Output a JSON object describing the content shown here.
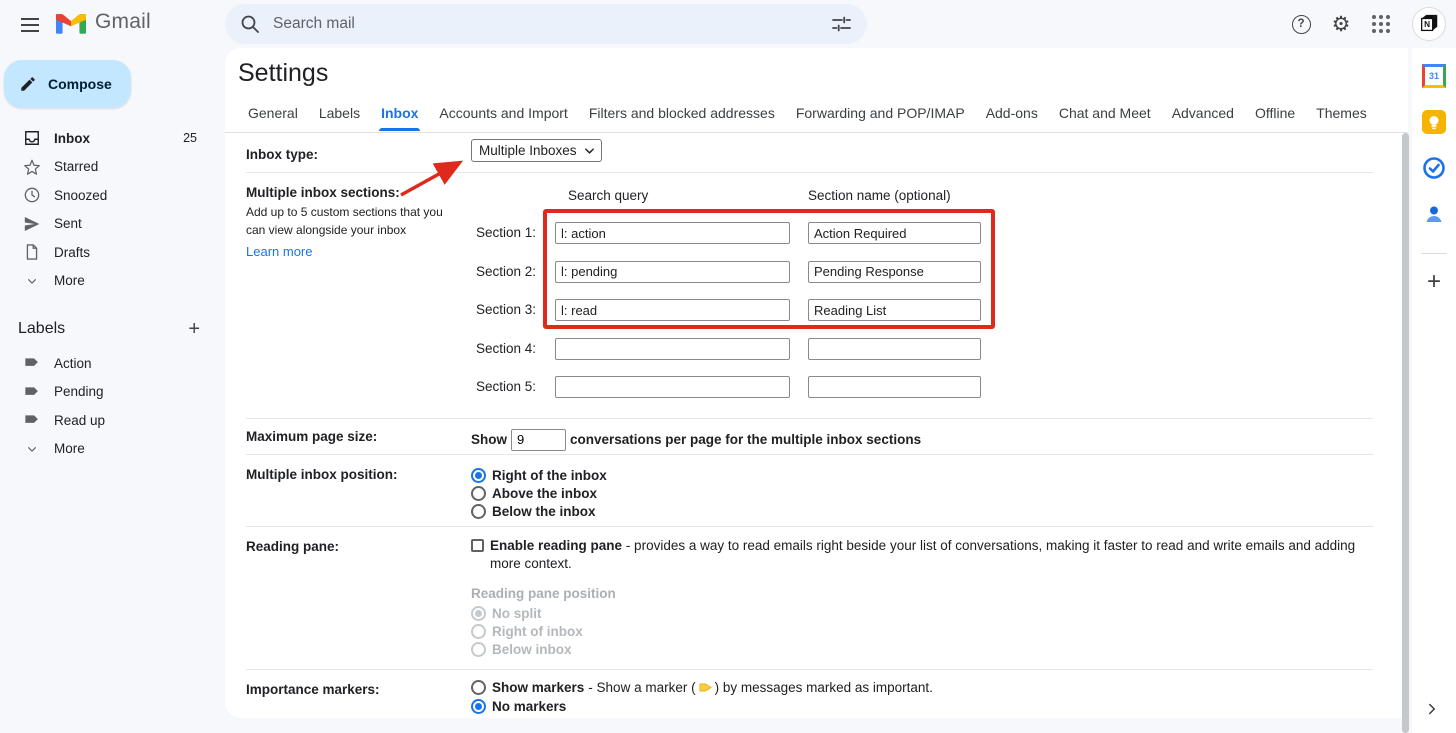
{
  "topbar": {
    "brand": "Gmail",
    "search": {
      "placeholder": "Search mail"
    },
    "icons": {
      "help_glyph": "?",
      "gear_glyph": "⚙",
      "avatar_letter": "N"
    }
  },
  "sidebar": {
    "compose": "Compose",
    "items": [
      {
        "label": "Inbox",
        "count": "25"
      },
      {
        "label": "Starred"
      },
      {
        "label": "Snoozed"
      },
      {
        "label": "Sent"
      },
      {
        "label": "Drafts"
      },
      {
        "label": "More"
      }
    ],
    "labels_header": "Labels",
    "labels_plus": "+",
    "labels": [
      {
        "label": "Action"
      },
      {
        "label": "Pending"
      },
      {
        "label": "Read up"
      },
      {
        "label": "More"
      }
    ]
  },
  "settings": {
    "title": "Settings",
    "tabs": [
      "General",
      "Labels",
      "Inbox",
      "Accounts and Import",
      "Filters and blocked addresses",
      "Forwarding and POP/IMAP",
      "Add-ons",
      "Chat and Meet",
      "Advanced",
      "Offline",
      "Themes"
    ],
    "active_tab": "Inbox",
    "inbox_type": {
      "label": "Inbox type:",
      "value": "Multiple Inboxes"
    },
    "sections": {
      "label": "Multiple inbox sections:",
      "description": "Add up to 5 custom sections that you can view alongside your inbox",
      "learn_more": "Learn more",
      "col_query": "Search query",
      "col_name": "Section name (optional)",
      "rows": [
        {
          "label": "Section 1:",
          "query": "l: action",
          "name": "Action Required"
        },
        {
          "label": "Section 2:",
          "query": "l: pending",
          "name": "Pending Response"
        },
        {
          "label": "Section 3:",
          "query": "l: read",
          "name": "Reading List"
        },
        {
          "label": "Section 4:",
          "query": "",
          "name": ""
        },
        {
          "label": "Section 5:",
          "query": "",
          "name": ""
        }
      ]
    },
    "max_page_size": {
      "label": "Maximum page size:",
      "prefix": "Show",
      "value": "9",
      "suffix": "conversations per page for the multiple inbox sections"
    },
    "inbox_position": {
      "label": "Multiple inbox position:",
      "options": [
        "Right of the inbox",
        "Above the inbox",
        "Below the inbox"
      ],
      "selected": "Right of the inbox"
    },
    "reading_pane": {
      "label": "Reading pane:",
      "checkbox_label": "Enable reading pane",
      "description": "- provides a way to read emails right beside your list of conversations, making it faster to read and write emails and adding more context.",
      "checked": false,
      "position_header": "Reading pane position",
      "options": [
        "No split",
        "Right of inbox",
        "Below inbox"
      ],
      "selected": "No split"
    },
    "importance_markers": {
      "label": "Importance markers:",
      "show_label": "Show markers",
      "show_desc_pre": "- Show a marker (",
      "show_desc_post": ") by messages marked as important.",
      "no_label": "No markers",
      "selected": "No markers"
    }
  },
  "right_panel": {
    "calendar_day": "31",
    "get_addons": "+",
    "collapse": "›"
  },
  "colors": {
    "accent_blue": "#1a73e8",
    "annotation_red": "#e0291d",
    "compose_bg": "#c2e7ff",
    "topbar_bg": "#f6f8fc",
    "search_bg": "#eaf1fb",
    "marker_yellow": "#f7cb4d"
  }
}
